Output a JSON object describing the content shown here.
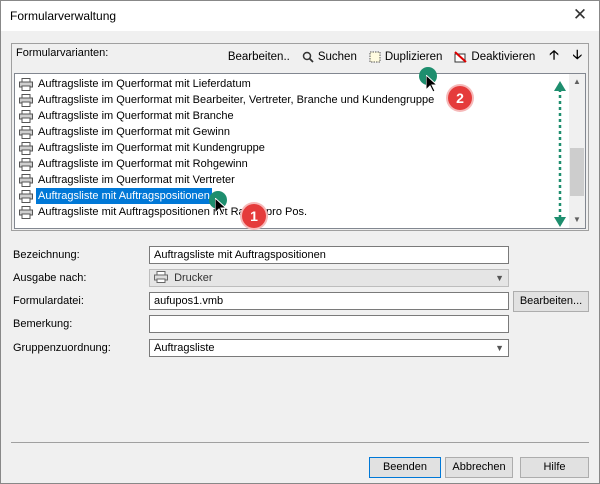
{
  "window": {
    "title": "Formularverwaltung"
  },
  "group": {
    "label": "Formularvarianten:",
    "toolbar": {
      "edit": "Bearbeiten..",
      "search": "Suchen",
      "duplicate": "Duplizieren",
      "deactivate": "Deaktivieren"
    },
    "rows": [
      "Auftragsliste im Querformat mit Lieferdatum",
      "Auftragsliste im Querformat mit Bearbeiter, Vertreter, Branche und Kundengruppe",
      "Auftragsliste im Querformat mit Branche",
      "Auftragsliste im Querformat mit Gewinn",
      "Auftragsliste im Querformat mit Kundengruppe",
      "Auftragsliste im Querformat mit Rohgewinn",
      "Auftragsliste im Querformat mit Vertreter",
      "Auftragsliste mit Auftragspositionen",
      "Auftragsliste mit Auftragspositionen mit Rabatt pro Pos."
    ],
    "selected_index": 7
  },
  "form": {
    "label_designation": "Bezeichnung:",
    "designation": "Auftragsliste mit Auftragspositionen",
    "label_output": "Ausgabe nach:",
    "output": "Drucker",
    "label_file": "Formulardatei:",
    "file": "aufupos1.vmb",
    "edit_file": "Bearbeiten...",
    "label_remark": "Bemerkung:",
    "remark": "",
    "label_group": "Gruppenzuordnung:",
    "group": "Auftragsliste"
  },
  "buttons": {
    "finish": "Beenden",
    "cancel": "Abbrechen",
    "help": "Hilfe"
  },
  "annotations": {
    "badge1": "1",
    "badge2": "2"
  },
  "colors": {
    "selection": "#0078d7",
    "marker": "#1e8e6e",
    "badge": "#e53b3b",
    "arrow": "#1e8e6e"
  }
}
